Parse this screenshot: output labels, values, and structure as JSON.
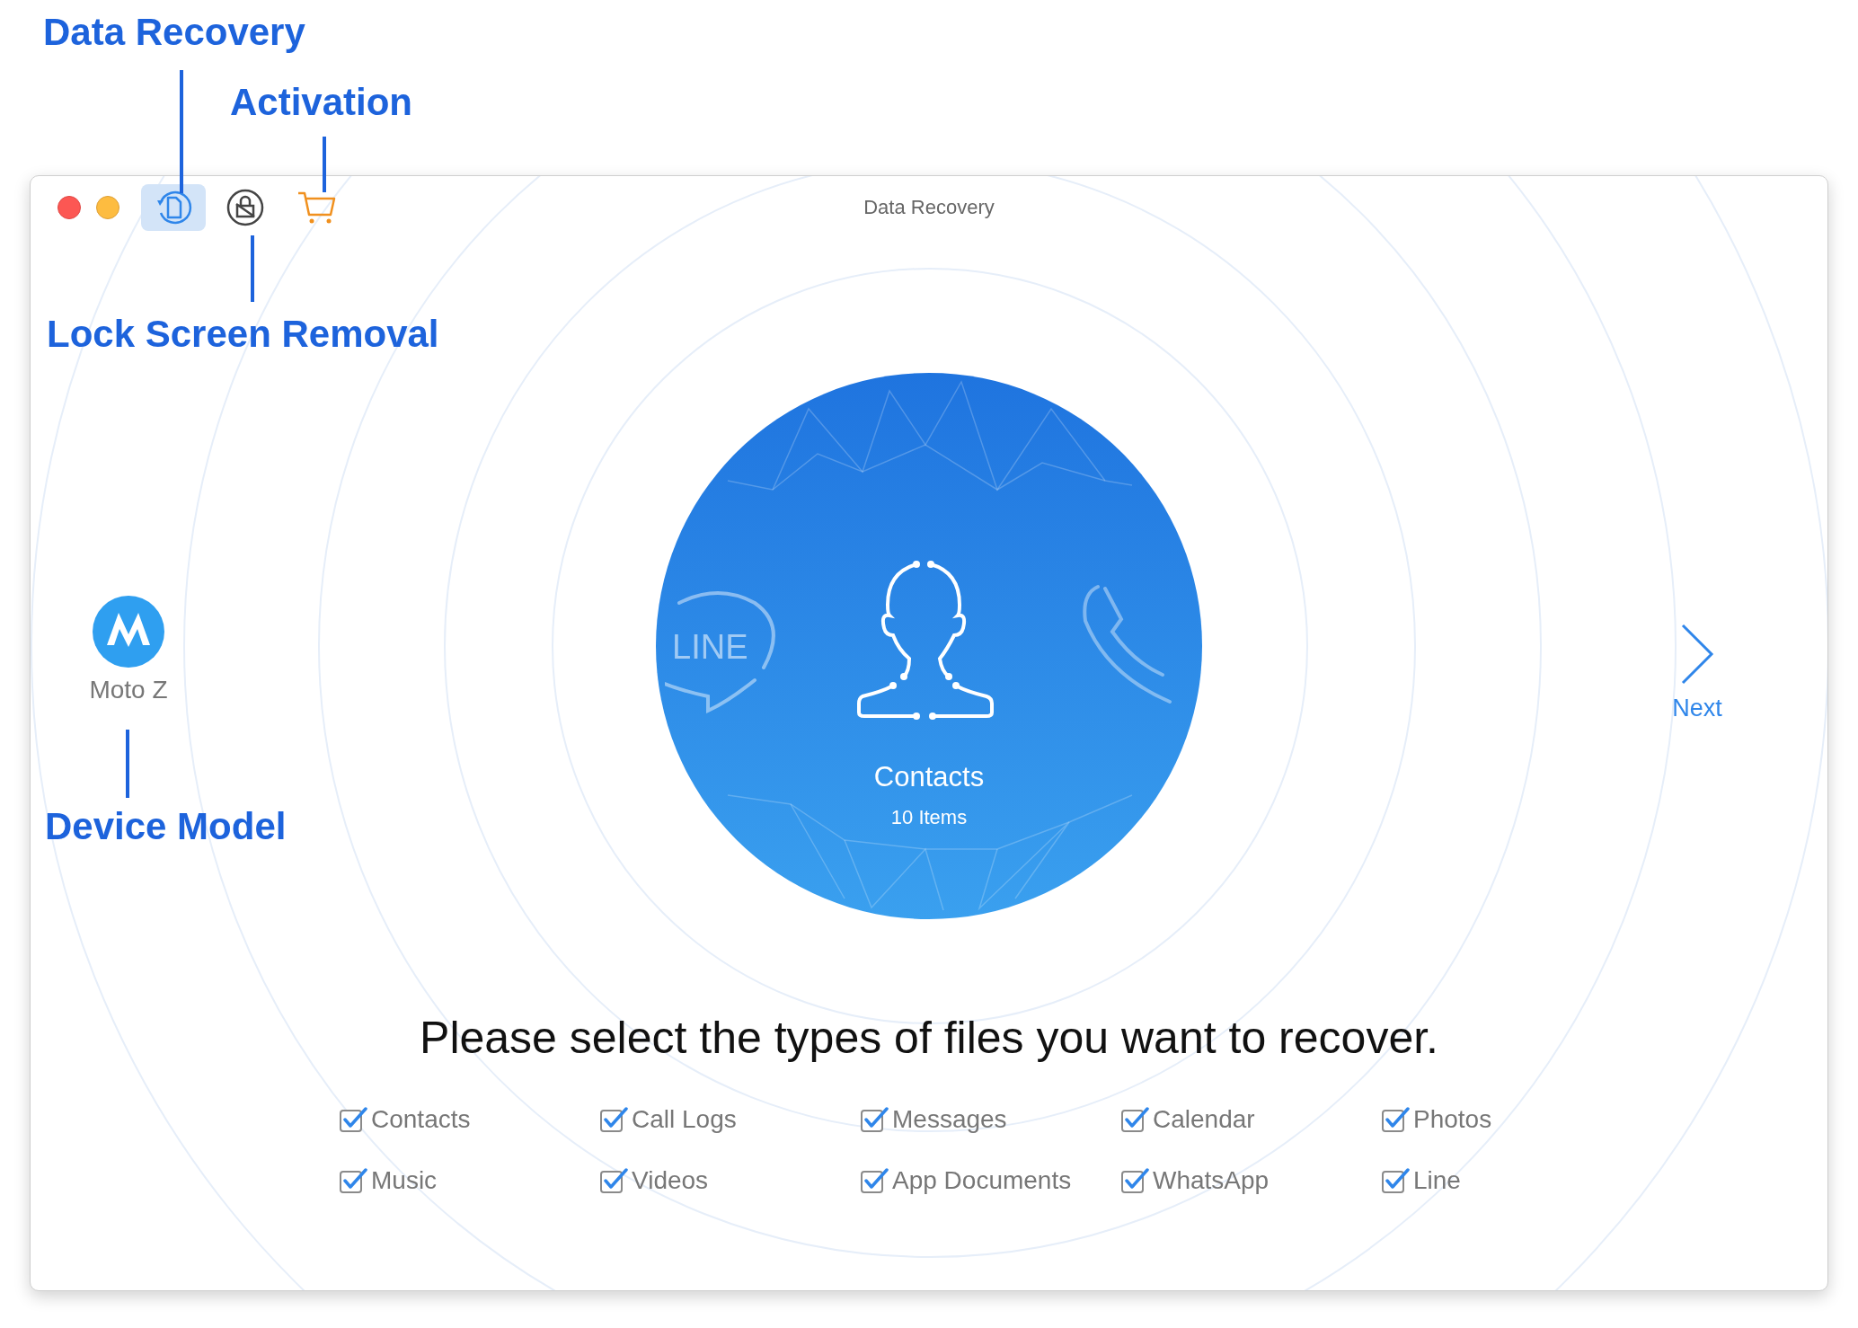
{
  "annotations": [
    {
      "label": "Data Recovery"
    },
    {
      "label": "Activation"
    },
    {
      "label": "Lock Screen Removal"
    },
    {
      "label": "Device Model"
    }
  ],
  "window": {
    "title": "Data Recovery"
  },
  "toolbar": [
    {
      "kind": "recovery",
      "selected": true
    },
    {
      "kind": "unlock",
      "selected": false
    },
    {
      "kind": "cart",
      "selected": false
    }
  ],
  "device": {
    "name": "Moto Z"
  },
  "category": {
    "name": "Contacts",
    "count": "10 Items",
    "line_logo": "LINE"
  },
  "next": {
    "label": "Next"
  },
  "prompt": "Please select the types of files you want to recover.",
  "file_types": [
    {
      "label": "Contacts",
      "checked": true
    },
    {
      "label": "Call Logs",
      "checked": true
    },
    {
      "label": "Messages",
      "checked": true
    },
    {
      "label": "Calendar",
      "checked": true
    },
    {
      "label": "Photos",
      "checked": true
    },
    {
      "label": "Music",
      "checked": true
    },
    {
      "label": "Videos",
      "checked": true
    },
    {
      "label": "App Documents",
      "checked": true
    },
    {
      "label": "WhatsApp",
      "checked": true
    },
    {
      "label": "Line",
      "checked": true
    }
  ]
}
